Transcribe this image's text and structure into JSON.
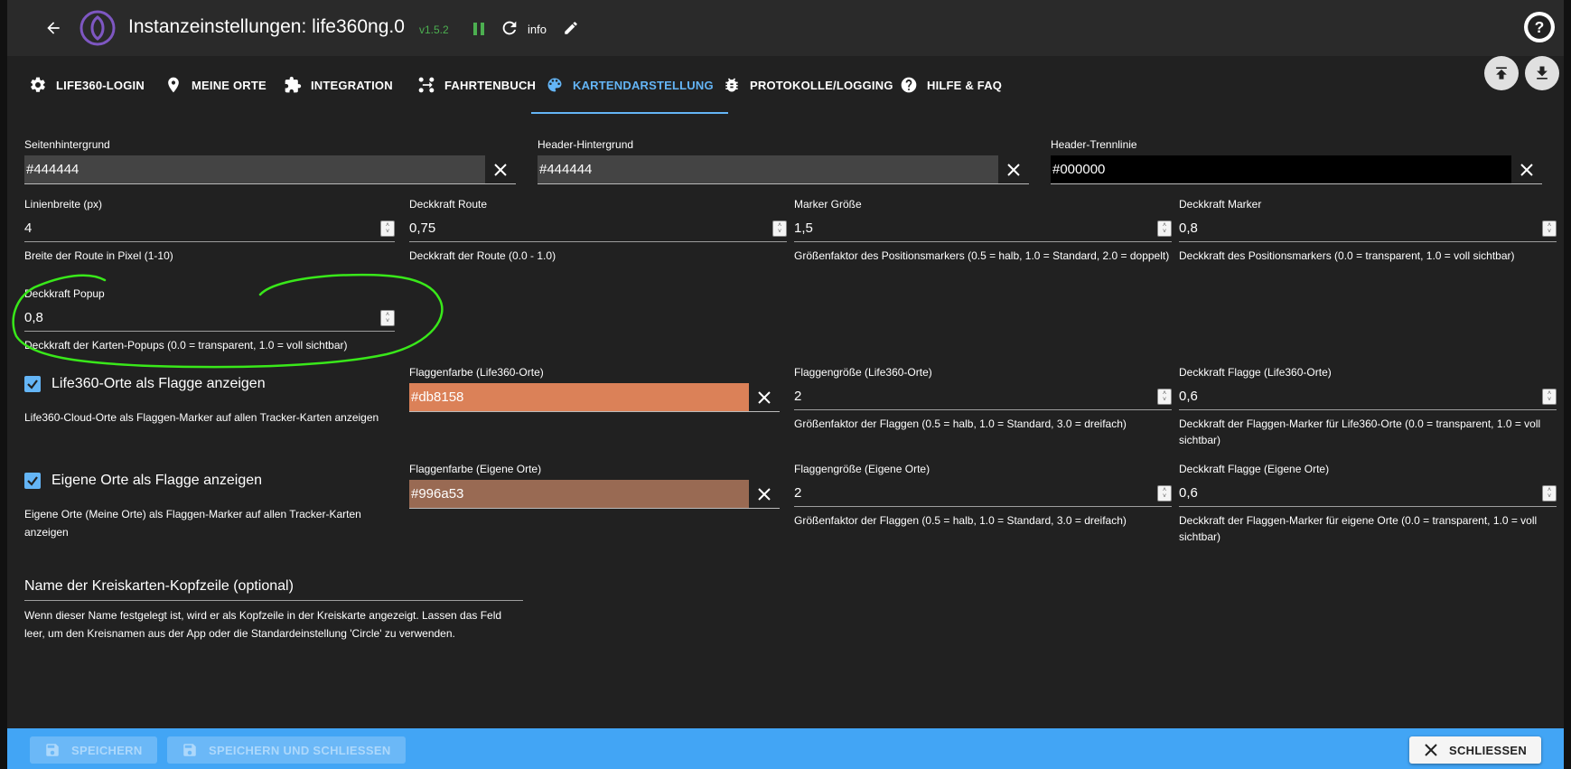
{
  "header": {
    "title": "Instanzeinstellungen: life360ng.0",
    "version": "v1.5.2",
    "loglevel": "info"
  },
  "tabs": [
    {
      "label": "LIFE360-LOGIN",
      "icon": "gear-icon"
    },
    {
      "label": "MEINE ORTE",
      "icon": "location-pin-icon"
    },
    {
      "label": "INTEGRATION",
      "icon": "puzzle-icon"
    },
    {
      "label": "FAHRTENBUCH",
      "icon": "route-icon"
    },
    {
      "label": "KARTENDARSTELLUNG",
      "icon": "palette-icon",
      "active": true
    },
    {
      "label": "PROTOKOLLE/LOGGING",
      "icon": "bug-icon"
    },
    {
      "label": "HILFE & FAQ",
      "icon": "help-circle-icon"
    }
  ],
  "colors": {
    "page_bg": {
      "label": "Seitenhintergrund",
      "value": "#444444"
    },
    "header_bg": {
      "label": "Header-Hintergrund",
      "value": "#444444"
    },
    "header_divider": {
      "label": "Header-Trennlinie",
      "value": "#000000"
    }
  },
  "numbers": {
    "line_width": {
      "label": "Linienbreite (px)",
      "value": "4",
      "helper": "Breite der Route in Pixel (1-10)"
    },
    "route_opacity": {
      "label": "Deckkraft Route",
      "value": "0,75",
      "helper": "Deckkraft der Route (0.0 - 1.0)"
    },
    "marker_size": {
      "label": "Marker Größe",
      "value": "1,5",
      "helper": "Größenfaktor des Positionsmarkers (0.5 = halb, 1.0 = Standard, 2.0 = doppelt)"
    },
    "marker_opacity": {
      "label": "Deckkraft Marker",
      "value": "0,8",
      "helper": "Deckkraft des Positionsmarkers (0.0 = transparent, 1.0 = voll sichtbar)"
    },
    "popup_opacity": {
      "label": "Deckkraft Popup",
      "value": "0,8",
      "helper": "Deckkraft der Karten-Popups (0.0 = transparent, 1.0 = voll sichtbar)"
    }
  },
  "life360_places": {
    "checkbox_label": "Life360-Orte als Flagge anzeigen",
    "checked": true,
    "helper": "Life360-Cloud-Orte als Flaggen-Marker auf allen Tracker-Karten anzeigen",
    "flag_color": {
      "label": "Flaggenfarbe (Life360-Orte)",
      "value": "#db8158"
    },
    "flag_size": {
      "label": "Flaggengröße (Life360-Orte)",
      "value": "2",
      "helper": "Größenfaktor der Flaggen (0.5 = halb, 1.0 = Standard, 3.0 = dreifach)"
    },
    "flag_opacity": {
      "label": "Deckkraft Flagge (Life360-Orte)",
      "value": "0,6",
      "helper": "Deckkraft der Flaggen-Marker für Life360-Orte (0.0 = transparent, 1.0 = voll sichtbar)"
    }
  },
  "own_places": {
    "checkbox_label": "Eigene Orte als Flagge anzeigen",
    "checked": true,
    "helper": "Eigene Orte (Meine Orte) als Flaggen-Marker auf allen Tracker-Karten anzeigen",
    "flag_color": {
      "label": "Flaggenfarbe (Eigene Orte)",
      "value": "#996a53"
    },
    "flag_size": {
      "label": "Flaggengröße (Eigene Orte)",
      "value": "2",
      "helper": "Größenfaktor der Flaggen (0.5 = halb, 1.0 = Standard, 3.0 = dreifach)"
    },
    "flag_opacity": {
      "label": "Deckkraft Flagge (Eigene Orte)",
      "value": "0,6",
      "helper": "Deckkraft der Flaggen-Marker für eigene Orte (0.0 = transparent, 1.0 = voll sichtbar)"
    }
  },
  "circle_header": {
    "label": "Name der Kreiskarten-Kopfzeile (optional)",
    "helper": "Wenn dieser Name festgelegt ist, wird er als Kopfzeile in der Kreiskarte angezeigt. Lassen das Feld leer, um den Kreisnamen aus der App oder die Standardeinstellung 'Circle' zu verwenden."
  },
  "footer": {
    "save": "SPEICHERN",
    "save_close": "SPEICHERN UND SCHLIESSEN",
    "close": "SCHLIESSEN"
  },
  "theme": {
    "accent": "#64b5f6",
    "footer_bg": "#42a5f5",
    "version_color": "#4caf50",
    "annotation_color": "#39e81a"
  }
}
